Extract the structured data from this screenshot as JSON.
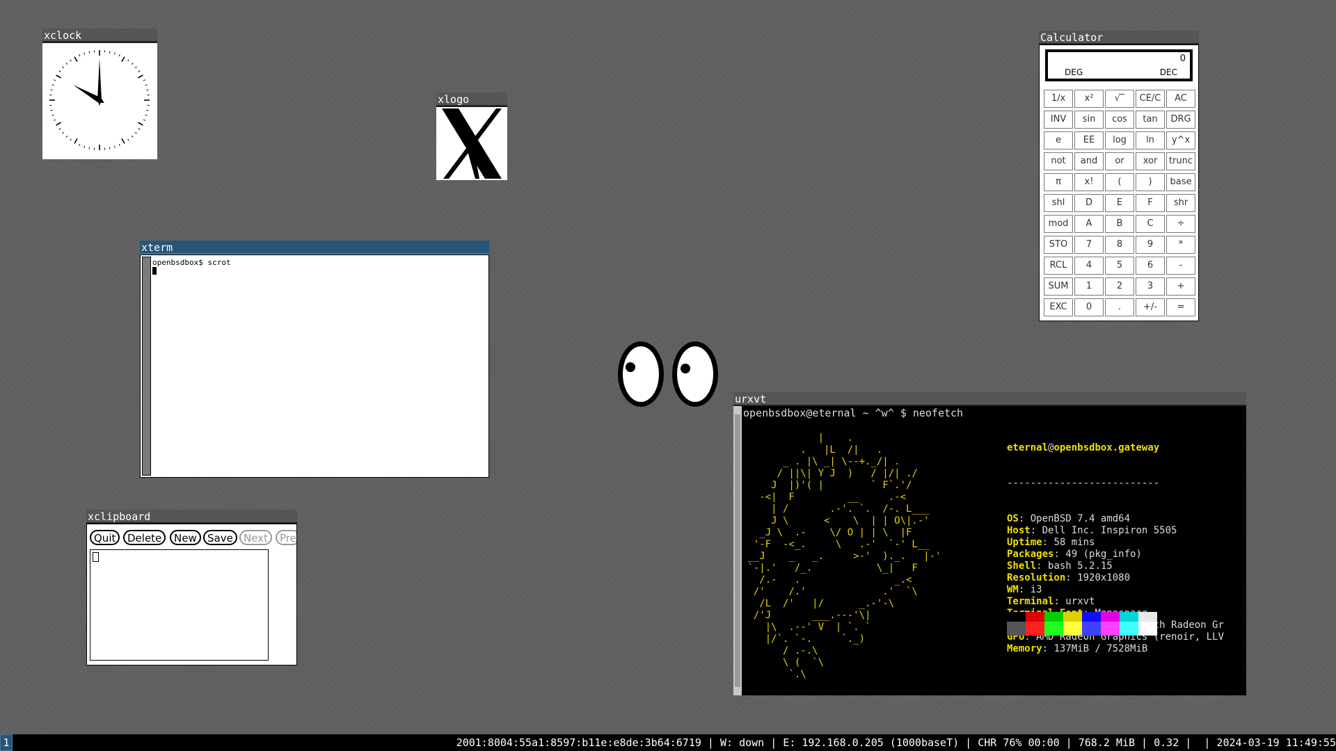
{
  "windows": {
    "xclock": {
      "title": "xclock",
      "time": {
        "hour": 10,
        "minute": 0,
        "second": 0
      }
    },
    "xlogo": {
      "title": "xlogo"
    },
    "xterm": {
      "title": "xterm",
      "prompt": "openbsdbox$ scrot"
    },
    "xclipboard": {
      "title": "xclipboard",
      "buttons": [
        "Quit",
        "Delete",
        "New",
        "Save",
        "Next",
        "Pre"
      ]
    },
    "calculator": {
      "title": "Calculator",
      "display_value": "0",
      "angle_mode": "DEG",
      "base_mode": "DEC",
      "keys": [
        "1/x",
        "x²",
        "√‾",
        "CE/C",
        "AC",
        "INV",
        "sin",
        "cos",
        "tan",
        "DRG",
        "e",
        "EE",
        "log",
        "ln",
        "y^x",
        "not",
        "and",
        "or",
        "xor",
        "trunc",
        "π",
        "x!",
        "(",
        ")",
        "base",
        "shl",
        "D",
        "E",
        "F",
        "shr",
        "mod",
        "A",
        "B",
        "C",
        "÷",
        "STO",
        "7",
        "8",
        "9",
        "*",
        "RCL",
        "4",
        "5",
        "6",
        "-",
        "SUM",
        "1",
        "2",
        "3",
        "+",
        "EXC",
        "0",
        ".",
        "+/-",
        "="
      ]
    },
    "xeyes": {},
    "urxvt": {
      "title": "urxvt",
      "command_line": "openbsdbox@eternal ~ ^w^ $ neofetch",
      "user_host_user": "eternal",
      "user_host_at": "@",
      "user_host_host": "openbsdbox.gateway",
      "separator": "--------------------------",
      "info": [
        {
          "key": "OS",
          "value": "OpenBSD 7.4 amd64"
        },
        {
          "key": "Host",
          "value": "Dell Inc. Inspiron 5505"
        },
        {
          "key": "Uptime",
          "value": "58 mins"
        },
        {
          "key": "Packages",
          "value": "49 (pkg_info)"
        },
        {
          "key": "Shell",
          "value": "bash 5.2.15"
        },
        {
          "key": "Resolution",
          "value": "1920x1080"
        },
        {
          "key": "WM",
          "value": "i3"
        },
        {
          "key": "Terminal",
          "value": "urxvt"
        },
        {
          "key": "Terminal Font",
          "value": "Monospace"
        },
        {
          "key": "CPU",
          "value": "AMD Ryzen 7 4700U with Radeon Gr"
        },
        {
          "key": "GPU",
          "value": "AMD Radeon Graphics (renoir, LLV"
        },
        {
          "key": "Memory",
          "value": "137MiB / 7528MiB"
        }
      ],
      "palette_top": [
        "#000000",
        "#e00000",
        "#00d000",
        "#e0d000",
        "#1010f0",
        "#e000e0",
        "#00d8d8",
        "#e8e8e8"
      ],
      "palette_bottom": [
        "#555555",
        "#ff2020",
        "#20ff20",
        "#ffff40",
        "#4040ff",
        "#ff40ff",
        "#40ffff",
        "#ffffff"
      ]
    }
  },
  "statusbar": {
    "workspace": "1",
    "status": "2001:8004:55a1:8597:b11e:e8de:3b64:6719 | W: down | E: 192.168.0.205 (1000baseT) | CHR 76% 00:00 | 768.2 MiB | 0.32 |  | 2024-03-19 11:49:55"
  }
}
